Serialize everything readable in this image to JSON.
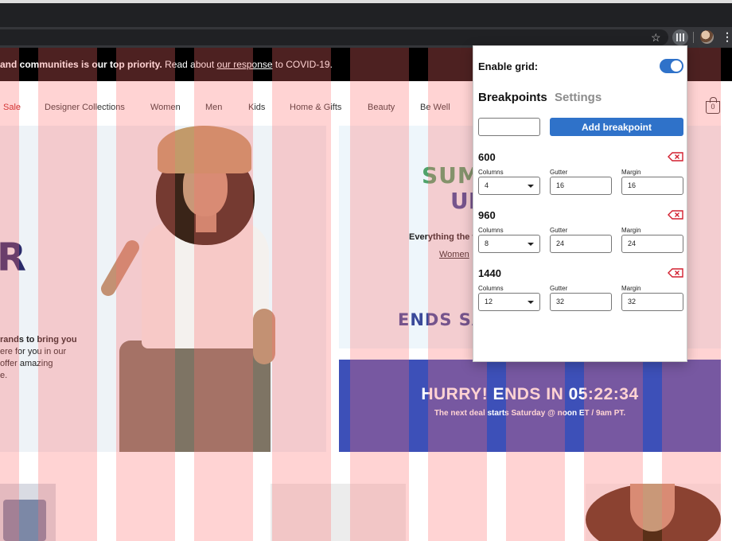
{
  "browser": {
    "star_icon": "star-icon",
    "extension_icon": "grid-extension-icon",
    "menu_glyph": "⋮"
  },
  "page": {
    "banner": {
      "strong": "and communities is our top priority.",
      "pre_link": " Read about ",
      "link": "our response",
      "post_link": " to COVID-19."
    },
    "nav": [
      "Sale",
      "Designer Collections",
      "Women",
      "Men",
      "Kids",
      "Home & Gifts",
      "Beauty",
      "Be Well"
    ],
    "bag_count": "0",
    "hero_left": {
      "big_letter": "R",
      "copy_bold": "rands to bring you",
      "copy_lines": [
        "ere for you in our",
        "offer amazing",
        "e."
      ]
    },
    "hero_right": {
      "title_line1": "SUMM",
      "title_line2": "UP",
      "everything": "Everything the w",
      "link": "Women",
      "ends": "ENDS SATU"
    },
    "hurry": {
      "title": "HURRY! ENDS IN 05:22:34",
      "subtitle": "The next deal starts Saturday @ noon ET / 9am PT."
    }
  },
  "popup": {
    "enable_label": "Enable grid:",
    "grid_enabled": true,
    "tabs": {
      "breakpoints": "Breakpoints",
      "settings": "Settings"
    },
    "new_breakpoint_value": "",
    "add_button": "Add breakpoint",
    "labels": {
      "columns": "Columns",
      "gutter": "Gutter",
      "margin": "Margin"
    },
    "breakpoints": [
      {
        "width": "600",
        "columns": "4",
        "gutter": "16",
        "margin": "16"
      },
      {
        "width": "960",
        "columns": "8",
        "gutter": "24",
        "margin": "24"
      },
      {
        "width": "1440",
        "columns": "12",
        "gutter": "32",
        "margin": "32"
      }
    ]
  },
  "colors": {
    "accent": "#2f72c9",
    "grid_column": "#ff6e6e",
    "delete": "#d21f2f"
  }
}
